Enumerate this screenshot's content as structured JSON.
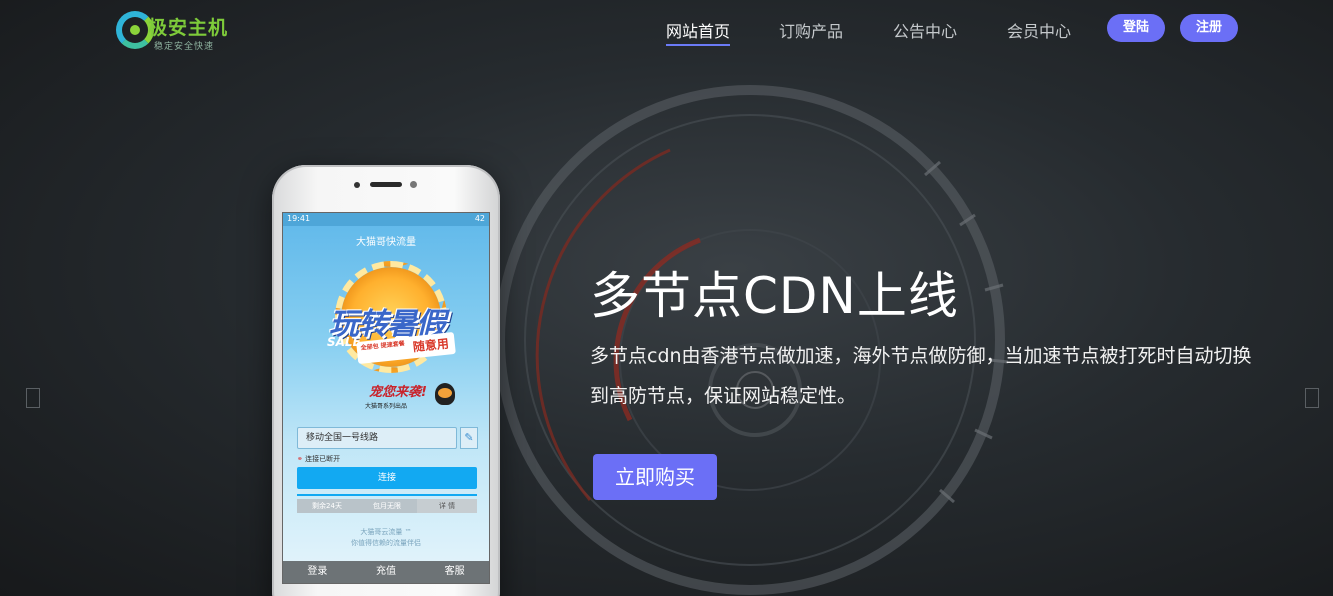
{
  "header": {
    "logo": {
      "title": "极安主机",
      "subtitle": "稳定安全快速"
    },
    "nav": [
      {
        "label": "网站首页",
        "active": true
      },
      {
        "label": "订购产品",
        "active": false
      },
      {
        "label": "公告中心",
        "active": false
      },
      {
        "label": "会员中心",
        "active": false
      }
    ],
    "login_label": "登陆",
    "register_label": "注册"
  },
  "hero": {
    "title": "多节点CDN上线",
    "description": "多节点cdn由香港节点做加速，海外节点做防御，当加速节点被打死时自动切换到高防节点，保证网站稳定性。",
    "buy_label": "立即购买"
  },
  "carousel": {
    "prev_icon": "chevron-left-icon",
    "next_icon": "chevron-right-icon"
  },
  "phone": {
    "status_time": "19:41",
    "status_battery": "42",
    "app_title": "大猫哥快流量",
    "banner_title": "玩转暑假",
    "banner_sale": "SALE",
    "banner_tag_small": "全部包\n提速套餐",
    "banner_tag": "随意用",
    "banner_slogan": "宠您来袭!",
    "banner_credit": "大猫哥系列出品",
    "line_select": "移动全国一号线路",
    "conn_status": "连接已断开",
    "connect_label": "连接",
    "stats": [
      "剩余24天",
      "包月无限",
      "详 情"
    ],
    "footer_line1": "大猫哥云流量 ™",
    "footer_line2": "你值得信赖的流量伴侣",
    "tabs": [
      "登录",
      "充值",
      "客服"
    ]
  },
  "colors": {
    "accent": "#6b6ff6",
    "app_blue": "#12a9f2"
  }
}
